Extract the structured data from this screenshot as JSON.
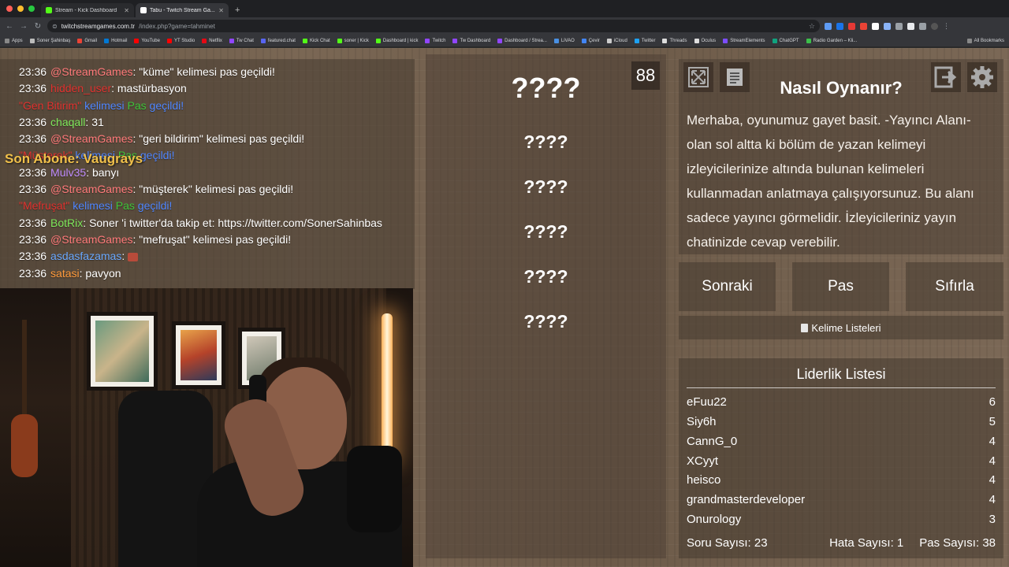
{
  "browser": {
    "tabs": [
      {
        "label": "Stream - Kick Dashboard",
        "favicon_color": "#53fc18"
      },
      {
        "label": "Tabu - Twitch Stream Ga...",
        "favicon_color": "#ffffff"
      }
    ],
    "address": {
      "host": "twitchstreamgames.com.tr",
      "path": "/index.php?game=tahminet"
    },
    "bookmarks": [
      {
        "label": "Apps",
        "color": "#888888"
      },
      {
        "label": "Soner Şahinbaş",
        "color": "#bbbbbb"
      },
      {
        "label": "Gmail",
        "color": "#ea4335"
      },
      {
        "label": "Hotmail",
        "color": "#0078d4"
      },
      {
        "label": "YouTube",
        "color": "#ff0000"
      },
      {
        "label": "YT Studio",
        "color": "#ff0000"
      },
      {
        "label": "Netflix",
        "color": "#e50914"
      },
      {
        "label": "Tw Chat",
        "color": "#9146ff"
      },
      {
        "label": "featured.chat",
        "color": "#5865f2"
      },
      {
        "label": "Kick Chat",
        "color": "#53fc18"
      },
      {
        "label": "soner | Kick",
        "color": "#53fc18"
      },
      {
        "label": "Dashboard | kick",
        "color": "#53fc18"
      },
      {
        "label": "Twitch",
        "color": "#9146ff"
      },
      {
        "label": "Tw Dashboard",
        "color": "#9146ff"
      },
      {
        "label": "Dashboard / Strea...",
        "color": "#9146ff"
      },
      {
        "label": "LiVAO",
        "color": "#4a90e2"
      },
      {
        "label": "Çevir",
        "color": "#4285f4"
      },
      {
        "label": "iCloud",
        "color": "#cccccc"
      },
      {
        "label": "Twitter",
        "color": "#1da1f2"
      },
      {
        "label": "Threads",
        "color": "#dddddd"
      },
      {
        "label": "Oculus",
        "color": "#dddddd"
      },
      {
        "label": "StreamElements",
        "color": "#7c4dff"
      },
      {
        "label": "ChatGPT",
        "color": "#10a37f"
      },
      {
        "label": "Radio Garden – Kli...",
        "color": "#3cbf4a"
      }
    ],
    "all_bookmarks": "All Bookmarks"
  },
  "chat": {
    "lines": [
      {
        "time": "23:36",
        "user": "@StreamGames",
        "user_color": "stream",
        "sep": ": ",
        "text": "\"küme\" kelimesi pas geçildi!"
      },
      {
        "time": "23:36",
        "user": "hidden_user",
        "user_color": "red",
        "sep": ": ",
        "text": "mastürbasyon"
      },
      {
        "time": "",
        "user": "",
        "user_color": "",
        "sep": "",
        "rich": [
          {
            "t": "\"Gen Bitirim\"",
            "c": "red"
          },
          {
            "t": " kelimesi ",
            "c": "blue"
          },
          {
            "t": "Pas",
            "c": "green"
          },
          {
            "t": " geçildi!",
            "c": "blue"
          }
        ]
      },
      {
        "time": "23:36",
        "user": "chaqall",
        "user_color": "green",
        "sep": ": ",
        "text": "31"
      },
      {
        "time": "23:36",
        "user": "@StreamGames",
        "user_color": "stream",
        "sep": ": ",
        "text": "\"geri bildirim\" kelimesi pas geçildi!"
      },
      {
        "time": "",
        "user": "",
        "user_color": "",
        "sep": "",
        "rich": [
          {
            "t": "\"Müşterek\"",
            "c": "red"
          },
          {
            "t": " kelimesi ",
            "c": "blue"
          },
          {
            "t": "Pas",
            "c": "green"
          },
          {
            "t": " geçildi!",
            "c": "blue"
          }
        ]
      },
      {
        "time": "23:36",
        "user": "Mulv35",
        "user_color": "purple",
        "sep": ": ",
        "text": "banyı"
      },
      {
        "time": "23:36",
        "user": "@StreamGames",
        "user_color": "stream",
        "sep": ": ",
        "text": "\"müşterek\" kelimesi pas geçildi!"
      },
      {
        "time": "",
        "user": "",
        "user_color": "",
        "sep": "",
        "rich": [
          {
            "t": "\"Mefruşat\"",
            "c": "red"
          },
          {
            "t": " kelimesi ",
            "c": "blue"
          },
          {
            "t": "Pas",
            "c": "green"
          },
          {
            "t": " geçildi!",
            "c": "blue"
          }
        ]
      },
      {
        "time": "23:36",
        "user": "BotRix",
        "user_color": "green",
        "sep": ": ",
        "text": "Soner 'i twitter'da takip et: https://twitter.com/SonerSahinbas"
      },
      {
        "time": "23:36",
        "user": "@StreamGames",
        "user_color": "stream",
        "sep": ": ",
        "text": "\"mefruşat\" kelimesi pas geçildi!"
      },
      {
        "time": "23:36",
        "user": "asdasfazamas",
        "user_color": "blue",
        "sep": ": ",
        "text": "",
        "emote": true
      },
      {
        "time": "23:36",
        "user": "satasi",
        "user_color": "orange",
        "sep": ": ",
        "text": "pavyon"
      }
    ],
    "sub_alert": "Son Abone: Vaugrays"
  },
  "game": {
    "timer": "88",
    "words": [
      "????",
      "????",
      "????",
      "????",
      "????",
      "????"
    ]
  },
  "howto": {
    "title": "Nasıl Oynanır?",
    "text": "Merhaba, oyunumuz gayet basit. -Yayıncı Alanı- olan sol altta ki bölüm de yazan kelimeyi izleyicilerinize altında bulunan kelimeleri kullanmadan anlatmaya çalışıyorsunuz. Bu alanı sadece yayıncı görmelidir. İzleyicileriniz yayın chatinizde cevap verebilir."
  },
  "controls": {
    "next": "Sonraki",
    "pass": "Pas",
    "reset": "Sıfırla",
    "word_lists": "Kelime Listeleri"
  },
  "leaderboard": {
    "title": "Liderlik Listesi",
    "rows": [
      {
        "name": "eFuu22",
        "score": "6"
      },
      {
        "name": "Siy6h",
        "score": "5"
      },
      {
        "name": "CannG_0",
        "score": "4"
      },
      {
        "name": "XCyyt",
        "score": "4"
      },
      {
        "name": "heisco",
        "score": "4"
      },
      {
        "name": "grandmasterdeveloper",
        "score": "4"
      },
      {
        "name": "Onurology",
        "score": "3"
      }
    ],
    "stats": {
      "questions": "Soru Sayısı: 23",
      "errors": "Hata Sayısı: 1",
      "passes": "Pas Sayısı: 38"
    }
  }
}
